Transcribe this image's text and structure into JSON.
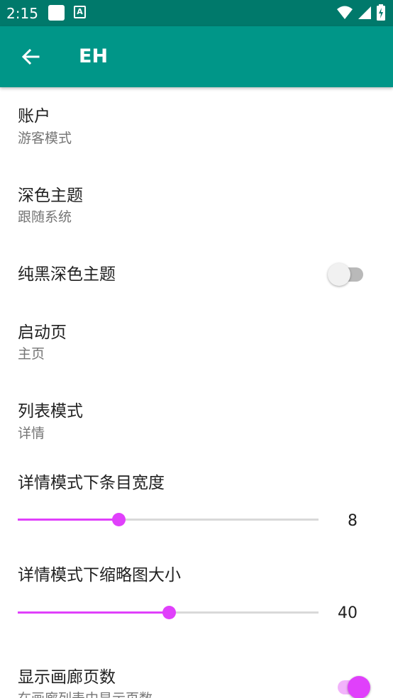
{
  "status_bar": {
    "time": "2:15",
    "letter_icon": "A"
  },
  "app_bar": {
    "title": "EH"
  },
  "colors": {
    "primary": "#009688",
    "primary_dark": "#00796b",
    "accent": "#e040fb"
  },
  "prefs": {
    "account": {
      "title": "账户",
      "summary": "游客模式"
    },
    "dark_theme": {
      "title": "深色主题",
      "summary": "跟随系统"
    },
    "black_dark_theme": {
      "title": "纯黑深色主题",
      "enabled": false
    },
    "launch_page": {
      "title": "启动页",
      "summary": "主页"
    },
    "list_mode": {
      "title": "列表模式",
      "summary": "详情"
    },
    "detail_item_width": {
      "title": "详情模式下条目宽度",
      "value": "8",
      "fraction": 0.335
    },
    "detail_thumb_size": {
      "title": "详情模式下缩略图大小",
      "value": "40",
      "fraction": 0.502
    },
    "show_gallery_pages": {
      "title": "显示画廊页数",
      "summary": "在画廊列表中显示页数",
      "enabled": true
    }
  }
}
